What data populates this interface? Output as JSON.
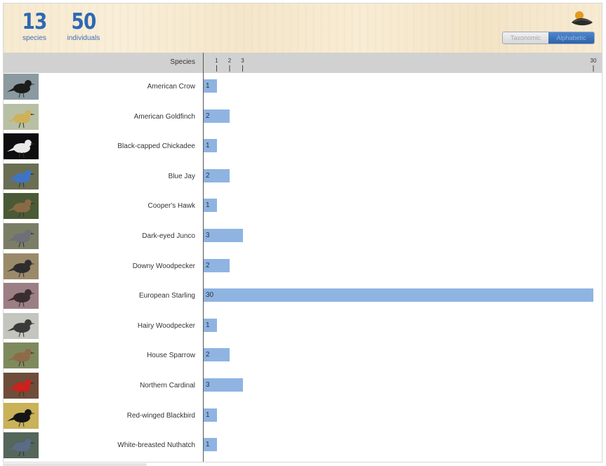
{
  "stats": {
    "species_count": "13",
    "species_label": "species",
    "individuals_count": "50",
    "individuals_label": "individuals"
  },
  "sort_toggle": {
    "taxonomic_label": "Taxonomic",
    "alphabetic_label": "Alphabetic",
    "selected": "Alphabetic"
  },
  "colors": {
    "bar": "#8fb4e2",
    "accent": "#2f68b3"
  },
  "chart_data": {
    "type": "bar",
    "orientation": "horizontal",
    "xlabel": "",
    "ylabel": "Species",
    "xlim": [
      0,
      30
    ],
    "x_ticks": [
      1,
      2,
      3,
      30
    ],
    "categories": [
      "American Crow",
      "American Goldfinch",
      "Black-capped Chickadee",
      "Blue Jay",
      "Cooper's Hawk",
      "Dark-eyed Junco",
      "Downy Woodpecker",
      "European Starling",
      "Hairy Woodpecker",
      "House Sparrow",
      "Northern Cardinal",
      "Red-winged Blackbird",
      "White-breasted Nuthatch"
    ],
    "values": [
      1,
      2,
      1,
      2,
      1,
      3,
      2,
      30,
      1,
      2,
      3,
      1,
      1
    ],
    "grid": false
  }
}
